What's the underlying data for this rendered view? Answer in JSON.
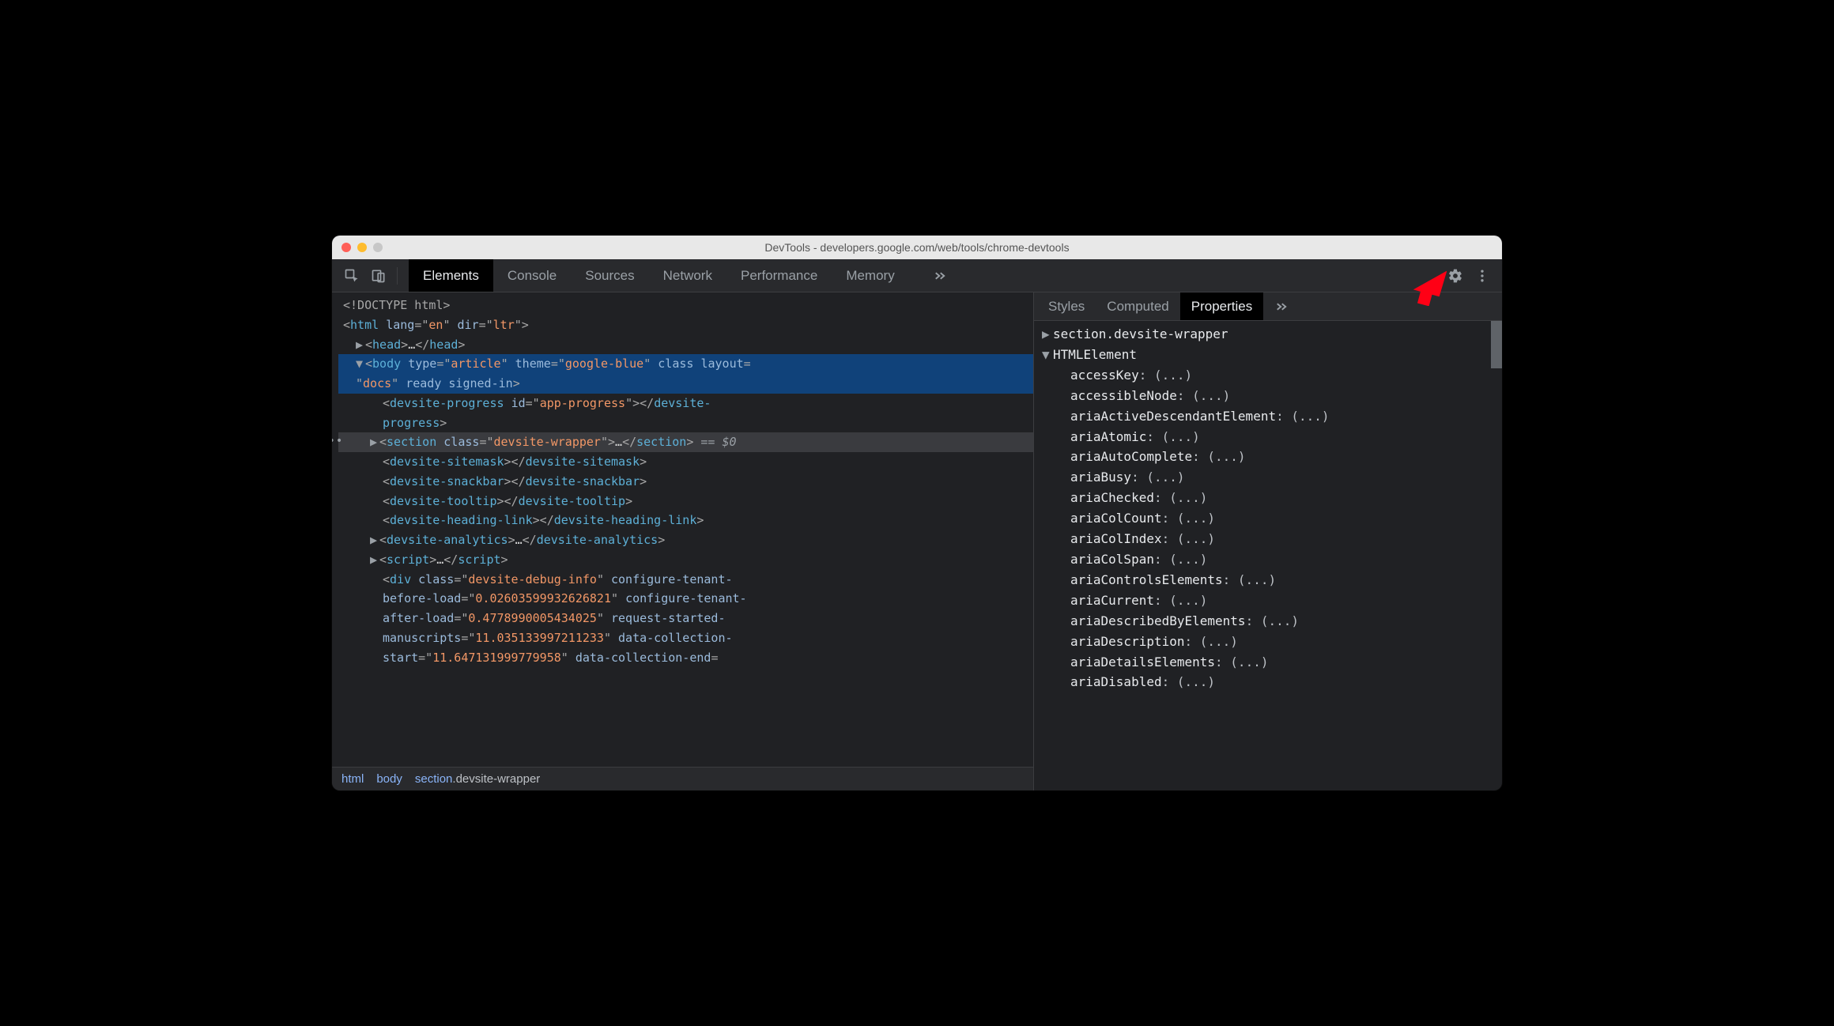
{
  "window": {
    "title": "DevTools - developers.google.com/web/tools/chrome-devtools"
  },
  "toolbar": {
    "tabs": [
      "Elements",
      "Console",
      "Sources",
      "Network",
      "Performance",
      "Memory"
    ],
    "activeTab": "Elements"
  },
  "dom": {
    "doctype": "<!DOCTYPE html>",
    "selectedSuffix": " == $0"
  },
  "domLines": [
    {
      "t": "html",
      "lang": "en",
      "dir": "ltr"
    },
    {
      "t": "head"
    },
    {
      "t": "body",
      "type": "article",
      "theme": "google-blue",
      "layout": "docs"
    },
    {
      "t": "devsite-progress",
      "id": "app-progress"
    },
    {
      "t": "section",
      "class": "devsite-wrapper"
    },
    {
      "t": "devsite-sitemask"
    },
    {
      "t": "devsite-snackbar"
    },
    {
      "t": "devsite-tooltip"
    },
    {
      "t": "devsite-heading-link"
    },
    {
      "t": "devsite-analytics"
    },
    {
      "t": "script"
    },
    {
      "t": "div",
      "class": "devsite-debug-info",
      "cfg_before": "0.02603599932626821",
      "cfg_after": "0.4778990005434025",
      "req_started": "11.035133997211233",
      "dc_start": "11.647131999779958"
    }
  ],
  "breadcrumb": [
    "html",
    "body",
    "section.devsite-wrapper"
  ],
  "sidebar": {
    "tabs": [
      "Styles",
      "Computed",
      "Properties"
    ],
    "activeTab": "Properties"
  },
  "props": {
    "node": "section.devsite-wrapper",
    "proto": "HTMLElement",
    "items": [
      "accessKey",
      "accessibleNode",
      "ariaActiveDescendantElement",
      "ariaAtomic",
      "ariaAutoComplete",
      "ariaBusy",
      "ariaChecked",
      "ariaColCount",
      "ariaColIndex",
      "ariaColSpan",
      "ariaControlsElements",
      "ariaCurrent",
      "ariaDescribedByElements",
      "ariaDescription",
      "ariaDetailsElements",
      "ariaDisabled"
    ],
    "ellipsis": "(...)"
  }
}
